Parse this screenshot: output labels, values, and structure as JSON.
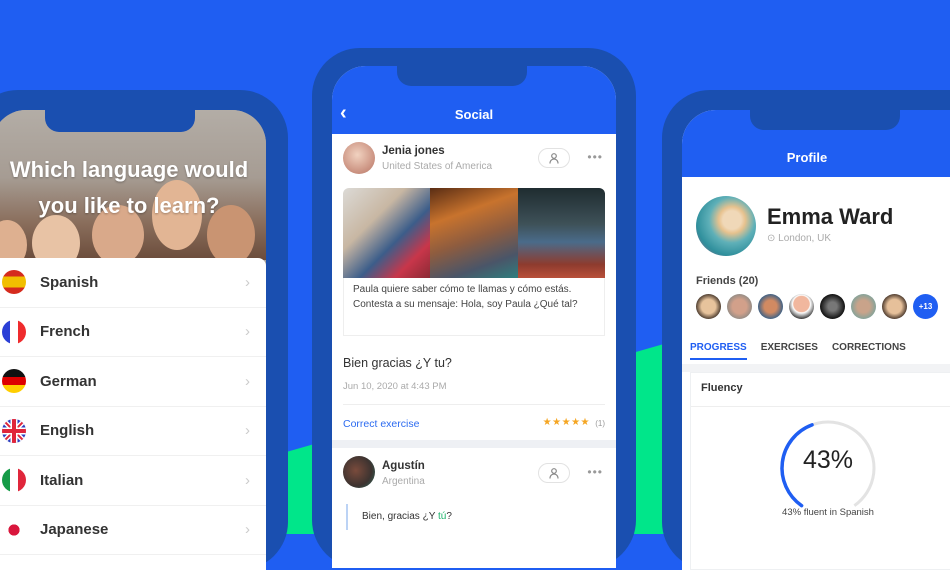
{
  "colors": {
    "background": "#1f5ef2",
    "phone_frame": "#1a4fb0",
    "accent_green": "#00e68a",
    "accent_blue": "#1f5ef2",
    "star": "#f5a623"
  },
  "language_screen": {
    "title": "Which language would you like to learn?",
    "languages": [
      {
        "label": "Spanish",
        "icon": "spain-flag-icon"
      },
      {
        "label": "French",
        "icon": "france-flag-icon"
      },
      {
        "label": "German",
        "icon": "germany-flag-icon"
      },
      {
        "label": "English",
        "icon": "uk-flag-icon"
      },
      {
        "label": "Italian",
        "icon": "italy-flag-icon"
      },
      {
        "label": "Japanese",
        "icon": "japan-flag-icon"
      }
    ],
    "chevron": "›"
  },
  "social_screen": {
    "title": "Social",
    "back_icon": "‹",
    "post": {
      "author": "Jenia jones",
      "country": "United States of America",
      "exercise_text": "Paula quiere saber cómo te llamas y cómo estás. Contesta a su mensaje: Hola, soy Paula ¿Qué tal?",
      "reply": "Bien gracias ¿Y tu?",
      "date": "Jun 10, 2020 at 4:43 PM",
      "correct_label": "Correct exercise",
      "stars": "★★★★★",
      "rating_count": "(1)",
      "more_icon": "•••"
    },
    "correction": {
      "author": "Agustín",
      "country": "Argentina",
      "text_before": "Bien, gracias ¿Y ",
      "text_highlight": "tú",
      "text_after": "?",
      "more_icon": "•••"
    }
  },
  "profile_screen": {
    "title": "Profile",
    "name": "Emma Ward",
    "location": "London, UK",
    "friends_label": "Friends (20)",
    "more_friends": "+13",
    "tabs": [
      "PROGRESS",
      "EXERCISES",
      "CORRECTIONS"
    ],
    "active_tab": "PROGRESS",
    "fluency": {
      "title": "Fluency",
      "language": "Spanish",
      "percent": 43,
      "percent_label": "43%",
      "caption": "43% fluent in Spanish"
    }
  }
}
